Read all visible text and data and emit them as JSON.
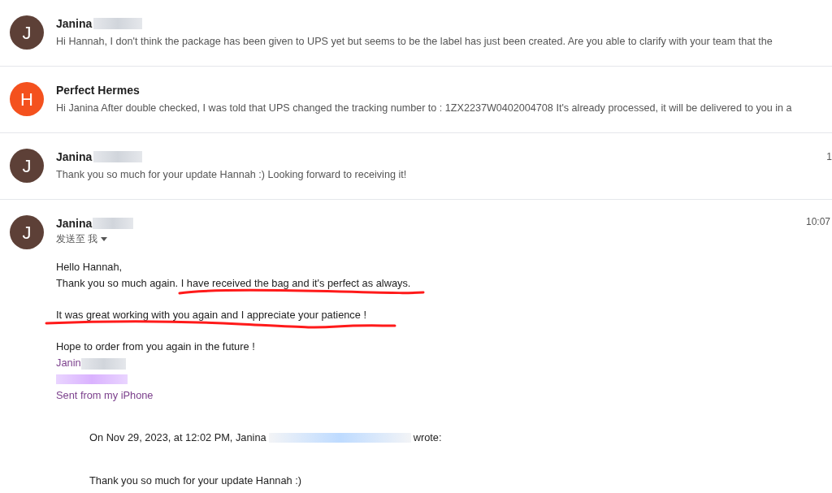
{
  "messages": [
    {
      "sender": "Janina",
      "avatar": {
        "letter": "J",
        "color": "#5d4037"
      },
      "snippet": "Hi Hannah, I don't think the package has been given to UPS yet but seems to be the label has just been created. Are you able to clarify with your team that the",
      "sender_redacted": true
    },
    {
      "sender": "Perfect Hermes",
      "avatar": {
        "letter": "H",
        "color": "#f4511e"
      },
      "snippet": "Hi Janina After double checked, I was told that UPS changed the tracking number to : 1ZX2237W0402004708 It's already processed, it will be delivered to you in a",
      "sender_redacted": false
    },
    {
      "sender": "Janina",
      "avatar": {
        "letter": "J",
        "color": "#5d4037"
      },
      "snippet": "Thank you so much for your update Hannah :) Looking forward to receiving it!",
      "sender_redacted": true,
      "time": "1"
    }
  ],
  "open_message": {
    "sender": "Janina",
    "avatar": {
      "letter": "J",
      "color": "#5d4037"
    },
    "time": "10:07",
    "recipient": "发送至 我",
    "body": [
      {
        "kind": "text",
        "text": "Hello Hannah,",
        "underlined": false
      },
      {
        "kind": "text",
        "text": "Thank you so much again. I have received the bag and it's perfect as always.",
        "underlined": true
      },
      {
        "kind": "gap"
      },
      {
        "kind": "text",
        "text": "It was great working with you again and I appreciate your patience !",
        "underlined": true
      },
      {
        "kind": "gap"
      },
      {
        "kind": "text",
        "text": "Hope to order from you again in the future !",
        "underlined": false
      },
      {
        "kind": "signature",
        "text": "Janin"
      },
      {
        "kind": "redacted"
      },
      {
        "kind": "signature",
        "text": "Sent from my iPhone"
      }
    ],
    "quote": {
      "intro_before": "On Nov 29, 2023, at 12:02 PM, Janina",
      "intro_after": "wrote:",
      "text": "Thank you so much for your update Hannah :)"
    }
  }
}
